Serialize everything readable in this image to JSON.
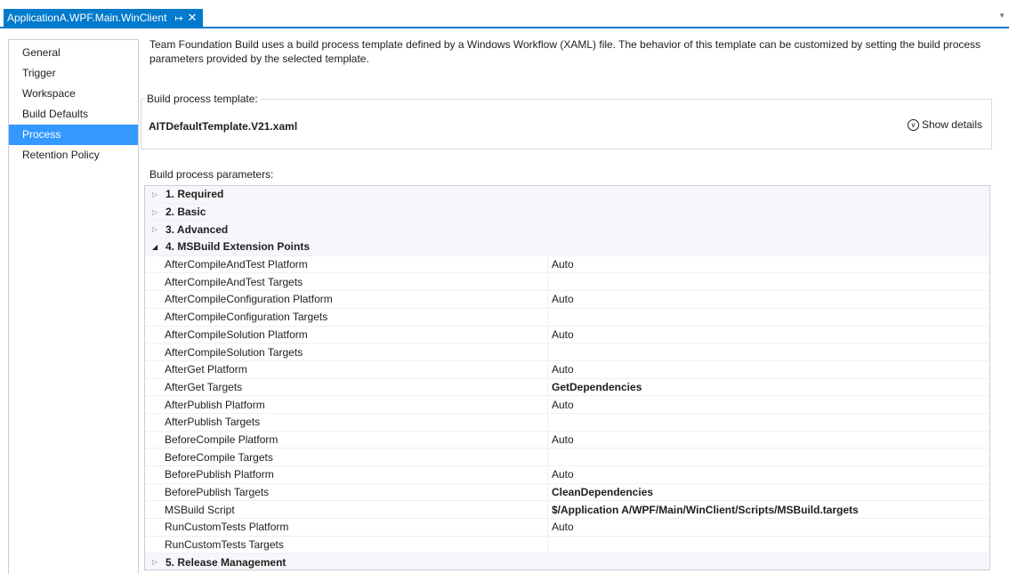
{
  "document_tab": {
    "title": "ApplicationA.WPF.Main.WinClient",
    "pin_icon": "pin-icon",
    "close_icon": "close-icon"
  },
  "nav": {
    "items": [
      {
        "label": "General",
        "selected": false
      },
      {
        "label": "Trigger",
        "selected": false
      },
      {
        "label": "Workspace",
        "selected": false
      },
      {
        "label": "Build Defaults",
        "selected": false
      },
      {
        "label": "Process",
        "selected": true
      },
      {
        "label": "Retention Policy",
        "selected": false
      }
    ]
  },
  "intro_text": "Team Foundation Build uses a build process template defined by a Windows Workflow (XAML) file. The behavior of this template can be customized by setting the build process parameters provided by the selected template.",
  "template_group": {
    "label": "Build process template:",
    "template_name": "AITDefaultTemplate.V21.xaml",
    "show_details_label": "Show details",
    "show_details_icon": "chevron-down-circle-icon"
  },
  "params_label": "Build process parameters:",
  "parameter_grid": {
    "rows": [
      {
        "type": "category",
        "label": "1. Required",
        "expanded": false
      },
      {
        "type": "category",
        "label": "2. Basic",
        "expanded": false
      },
      {
        "type": "category",
        "label": "3. Advanced",
        "expanded": false
      },
      {
        "type": "category",
        "label": "4. MSBuild Extension Points",
        "expanded": true
      },
      {
        "type": "property",
        "name": "AfterCompileAndTest Platform",
        "value": "Auto",
        "bold": false
      },
      {
        "type": "property",
        "name": "AfterCompileAndTest Targets",
        "value": "",
        "bold": false
      },
      {
        "type": "property",
        "name": "AfterCompileConfiguration Platform",
        "value": "Auto",
        "bold": false
      },
      {
        "type": "property",
        "name": "AfterCompileConfiguration Targets",
        "value": "",
        "bold": false
      },
      {
        "type": "property",
        "name": "AfterCompileSolution Platform",
        "value": "Auto",
        "bold": false
      },
      {
        "type": "property",
        "name": "AfterCompileSolution Targets",
        "value": "",
        "bold": false
      },
      {
        "type": "property",
        "name": "AfterGet Platform",
        "value": "Auto",
        "bold": false
      },
      {
        "type": "property",
        "name": "AfterGet Targets",
        "value": "GetDependencies",
        "bold": true
      },
      {
        "type": "property",
        "name": "AfterPublish Platform",
        "value": "Auto",
        "bold": false
      },
      {
        "type": "property",
        "name": "AfterPublish Targets",
        "value": "",
        "bold": false
      },
      {
        "type": "property",
        "name": "BeforeCompile Platform",
        "value": "Auto",
        "bold": false
      },
      {
        "type": "property",
        "name": "BeforeCompile Targets",
        "value": "",
        "bold": false
      },
      {
        "type": "property",
        "name": "BeforePublish Platform",
        "value": "Auto",
        "bold": false
      },
      {
        "type": "property",
        "name": "BeforePublish Targets",
        "value": "CleanDependencies",
        "bold": true
      },
      {
        "type": "property",
        "name": "MSBuild Script",
        "value": "$/Application A/WPF/Main/WinClient/Scripts/MSBuild.targets",
        "bold": true
      },
      {
        "type": "property",
        "name": "RunCustomTests Platform",
        "value": "Auto",
        "bold": false
      },
      {
        "type": "property",
        "name": "RunCustomTests Targets",
        "value": "",
        "bold": false
      },
      {
        "type": "category",
        "label": "5. Release Management",
        "expanded": false
      }
    ]
  },
  "colors": {
    "accent": "#007acc",
    "selection": "#3399ff",
    "category_bg": "#f5f7fb",
    "border": "#cccedb"
  }
}
